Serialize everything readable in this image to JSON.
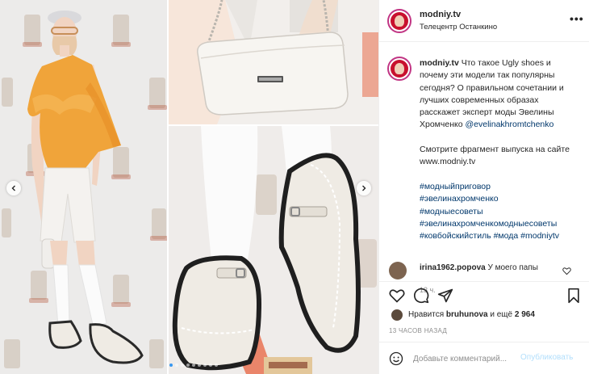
{
  "post": {
    "username": "modniy.tv",
    "location": "Телецентр Останкино",
    "more_label": "•••"
  },
  "caption": {
    "username": "modniy.tv",
    "text": "Что такое Ugly shoes и почему эти модели так популярны сегодня? О правильном сочетании и лучших современных образах расскажет эксперт моды Эвелины Хромченко",
    "mention": "@evelinakhromtchenko",
    "line2": "Смотрите фрагмент выпуска на сайте www.modniy.tv",
    "hashtags": [
      "#модныйприговор",
      "#эвелинахромченко",
      "#модныесоветы",
      "#эвелинахромченкомодныесоветы"
    ],
    "hashtags_last_line": [
      "#ковбойскийстиль",
      "#мода",
      "#modniytv"
    ],
    "time_ago": "13 ч."
  },
  "comment": {
    "username": "irina1962.popova",
    "text": "У моего папы"
  },
  "actions": {
    "like_icon": "heart-icon",
    "comment_icon": "comment-icon",
    "share_icon": "share-icon",
    "save_icon": "bookmark-icon"
  },
  "likes": {
    "prefix": "Нравится",
    "user": "bruhunova",
    "suffix": "и ещё",
    "count": "2 964"
  },
  "posted_ago": "13 ЧАСОВ НАЗАД",
  "add_comment": {
    "placeholder": "Добавьте комментарий...",
    "publish_label": "Опубликовать"
  },
  "carousel": {
    "slides": 9,
    "active_index": 0
  },
  "colors": {
    "link": "#00376b",
    "accent": "#3897f0",
    "publish_disabled": "#b2dffc",
    "muted": "#8e8e8e"
  }
}
